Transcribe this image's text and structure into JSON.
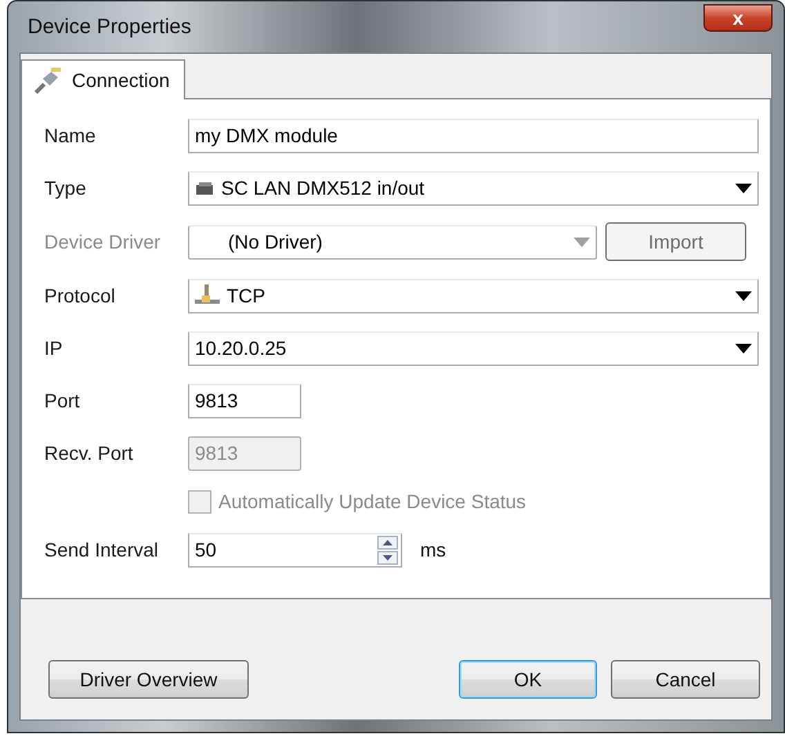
{
  "window": {
    "title": "Device Properties",
    "close_label": "x"
  },
  "tabs": [
    {
      "label": "Connection",
      "selected": true
    }
  ],
  "fields": [
    {
      "kind": "text",
      "label": "Name",
      "value": "my DMX module",
      "disabled": false
    },
    {
      "kind": "device_select",
      "label": "Type",
      "value": "SC LAN DMX512 in/out",
      "disabled": false
    },
    {
      "kind": "driver_select",
      "label": "Device Driver",
      "value": "(No Driver)",
      "disabled": true,
      "button": "Import"
    },
    {
      "kind": "protocol_select",
      "label": "Protocol",
      "value": "TCP",
      "disabled": false
    },
    {
      "kind": "select",
      "label": "IP",
      "value": "10.20.0.25",
      "disabled": false
    },
    {
      "kind": "short_text",
      "label": "Port",
      "value": "9813",
      "disabled": false
    },
    {
      "kind": "short_text",
      "label": "Recv. Port",
      "value": "9813",
      "disabled": true
    },
    {
      "kind": "checkbox",
      "label": "Automatically Update Device Status",
      "checked": false,
      "disabled": true
    },
    {
      "kind": "spin",
      "label": "Send Interval",
      "value": "50",
      "unit": "ms",
      "disabled": false
    }
  ],
  "buttons": [
    {
      "label": "Driver Overview",
      "default": false
    },
    {
      "label": "OK",
      "default": true
    },
    {
      "label": "Cancel",
      "default": false
    }
  ]
}
